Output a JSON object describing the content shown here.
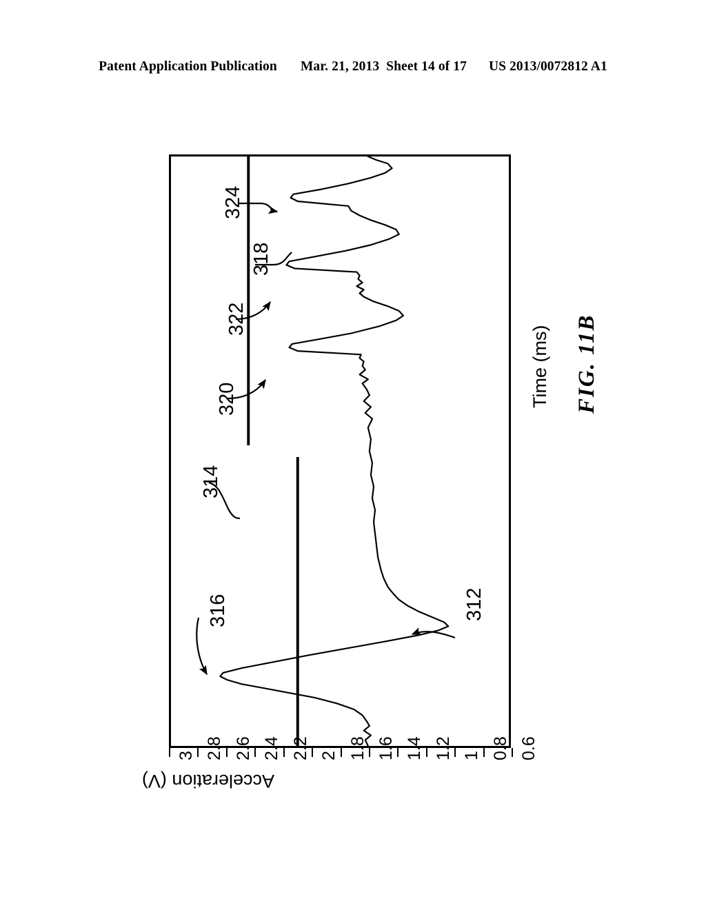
{
  "header": {
    "publication": "Patent Application Publication",
    "date": "Mar. 21, 2013",
    "sheet": "Sheet 14 of 17",
    "patent_number": "US 2013/0072812 A1"
  },
  "figure": {
    "caption": "FIG.  11B",
    "orientation": "rotated-90-ccw"
  },
  "labels": {
    "ref_312": "312",
    "ref_314": "314",
    "ref_316": "316",
    "ref_318": "318",
    "ref_320": "320",
    "ref_322": "322",
    "ref_324": "324"
  },
  "chart_data": {
    "type": "line",
    "title": "",
    "xlabel": "Time (ms)",
    "ylabel": "Acceleration (V)",
    "ylim": [
      0.6,
      3
    ],
    "y_ticks": [
      "3",
      "2.8",
      "2.6",
      "2.4",
      "2.2",
      "2",
      "1.8",
      "1.6",
      "1.4",
      "1.2",
      "1",
      "0.8",
      "0.6"
    ],
    "grid": false,
    "legend": "none",
    "annotations": [
      {
        "id": "312",
        "text": "312",
        "describes": "acceleration signal trace"
      },
      {
        "id": "314",
        "text": "314",
        "describes": "first threshold level, approx 2.45 V"
      },
      {
        "id": "316",
        "text": "316",
        "describes": "primary impact peak, approx 2.65 V"
      },
      {
        "id": "318",
        "text": "318",
        "describes": "second threshold level, approx 2.10 V"
      },
      {
        "id": "320",
        "text": "320",
        "describes": "first secondary peak crossing threshold 318"
      },
      {
        "id": "322",
        "text": "322",
        "describes": "second secondary peak crossing threshold 318"
      },
      {
        "id": "324",
        "text": "324",
        "describes": "third secondary peak crossing threshold 318"
      }
    ],
    "threshold_lines": [
      {
        "id": "314",
        "value": 2.45,
        "time_span_fraction": [
          0.51,
          1.0
        ]
      },
      {
        "id": "318",
        "value": 2.1,
        "time_span_fraction": [
          0.0,
          0.49
        ]
      }
    ],
    "series": [
      {
        "name": "312",
        "points": [
          [
            0.0,
            1.6
          ],
          [
            0.01,
            1.62
          ],
          [
            0.018,
            1.58
          ],
          [
            0.026,
            1.63
          ],
          [
            0.034,
            1.59
          ],
          [
            0.042,
            1.61
          ],
          [
            0.052,
            1.64
          ],
          [
            0.062,
            1.7
          ],
          [
            0.072,
            1.82
          ],
          [
            0.082,
            1.98
          ],
          [
            0.09,
            2.16
          ],
          [
            0.098,
            2.34
          ],
          [
            0.105,
            2.5
          ],
          [
            0.112,
            2.6
          ],
          [
            0.118,
            2.65
          ],
          [
            0.124,
            2.63
          ],
          [
            0.132,
            2.5
          ],
          [
            0.142,
            2.28
          ],
          [
            0.154,
            2.02
          ],
          [
            0.166,
            1.74
          ],
          [
            0.178,
            1.46
          ],
          [
            0.188,
            1.24
          ],
          [
            0.196,
            1.1
          ],
          [
            0.203,
            1.03
          ],
          [
            0.21,
            1.06
          ],
          [
            0.218,
            1.14
          ],
          [
            0.228,
            1.24
          ],
          [
            0.238,
            1.32
          ],
          [
            0.248,
            1.38
          ],
          [
            0.258,
            1.42
          ],
          [
            0.27,
            1.46
          ],
          [
            0.285,
            1.49
          ],
          [
            0.3,
            1.51
          ],
          [
            0.32,
            1.53
          ],
          [
            0.34,
            1.54
          ],
          [
            0.36,
            1.55
          ],
          [
            0.38,
            1.56
          ],
          [
            0.4,
            1.55
          ],
          [
            0.42,
            1.57
          ],
          [
            0.44,
            1.56
          ],
          [
            0.46,
            1.58
          ],
          [
            0.48,
            1.57
          ],
          [
            0.5,
            1.59
          ],
          [
            0.52,
            1.58
          ],
          [
            0.54,
            1.6
          ],
          [
            0.555,
            1.57
          ],
          [
            0.565,
            1.62
          ],
          [
            0.575,
            1.58
          ],
          [
            0.585,
            1.63
          ],
          [
            0.595,
            1.59
          ],
          [
            0.605,
            1.61
          ],
          [
            0.615,
            1.64
          ],
          [
            0.622,
            1.6
          ],
          [
            0.63,
            1.66
          ],
          [
            0.638,
            1.62
          ],
          [
            0.645,
            1.64
          ],
          [
            0.652,
            1.63
          ],
          [
            0.658,
            1.66
          ],
          [
            0.664,
            1.65
          ],
          [
            0.67,
            2.1
          ],
          [
            0.676,
            2.16
          ],
          [
            0.682,
            2.14
          ],
          [
            0.69,
            1.95
          ],
          [
            0.7,
            1.72
          ],
          [
            0.712,
            1.52
          ],
          [
            0.722,
            1.4
          ],
          [
            0.73,
            1.35
          ],
          [
            0.738,
            1.38
          ],
          [
            0.746,
            1.46
          ],
          [
            0.754,
            1.56
          ],
          [
            0.762,
            1.63
          ],
          [
            0.768,
            1.66
          ],
          [
            0.774,
            1.63
          ],
          [
            0.78,
            1.68
          ],
          [
            0.786,
            1.64
          ],
          [
            0.792,
            1.67
          ],
          [
            0.798,
            1.66
          ],
          [
            0.804,
            1.68
          ],
          [
            0.81,
            2.12
          ],
          [
            0.816,
            2.18
          ],
          [
            0.822,
            2.16
          ],
          [
            0.83,
            1.98
          ],
          [
            0.84,
            1.76
          ],
          [
            0.85,
            1.58
          ],
          [
            0.86,
            1.45
          ],
          [
            0.868,
            1.38
          ],
          [
            0.876,
            1.4
          ],
          [
            0.884,
            1.48
          ],
          [
            0.892,
            1.58
          ],
          [
            0.9,
            1.66
          ],
          [
            0.908,
            1.72
          ],
          [
            0.916,
            1.74
          ],
          [
            0.924,
            2.1
          ],
          [
            0.93,
            2.15
          ],
          [
            0.936,
            2.13
          ],
          [
            0.944,
            1.94
          ],
          [
            0.954,
            1.74
          ],
          [
            0.964,
            1.58
          ],
          [
            0.972,
            1.48
          ],
          [
            0.98,
            1.43
          ],
          [
            0.988,
            1.46
          ],
          [
            0.994,
            1.54
          ],
          [
            1.0,
            1.6
          ]
        ]
      }
    ]
  }
}
